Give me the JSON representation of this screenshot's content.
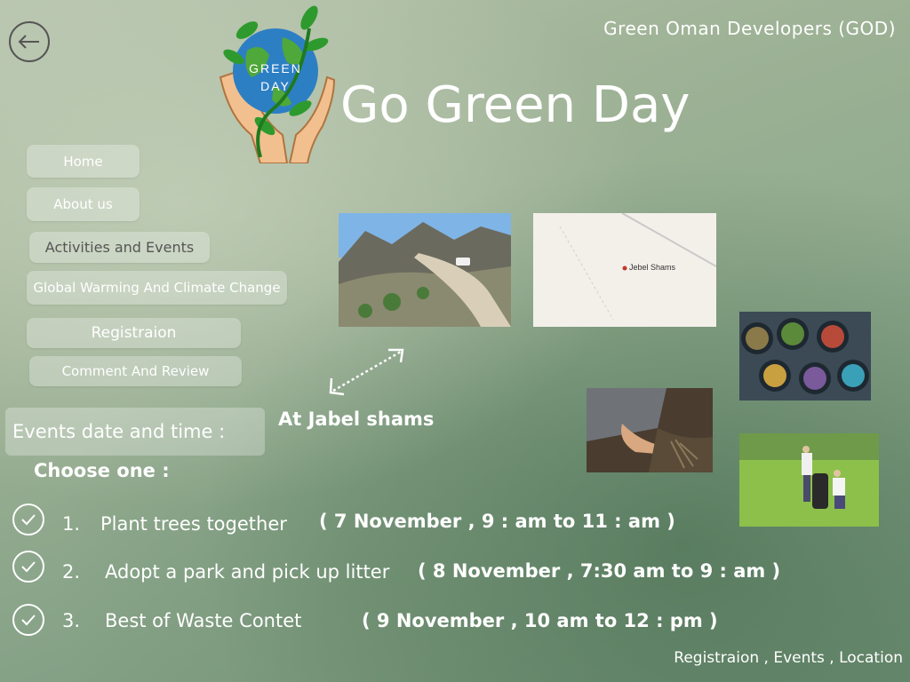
{
  "header": {
    "org_name": "Green Oman Developers (GOD)",
    "title": "Go Green Day",
    "logo_text": "GREEN DAY"
  },
  "nav": {
    "items": [
      {
        "label": "Home"
      },
      {
        "label": "About us"
      },
      {
        "label": "Activities and Events"
      },
      {
        "label": "Global Warming And Climate Change"
      },
      {
        "label": "Registraion"
      },
      {
        "label": "Comment And Review"
      }
    ]
  },
  "events": {
    "heading": "Events date and time  :",
    "choose_label": "Choose one :",
    "location_label": "At Jabel shams",
    "items": [
      {
        "num": "1.",
        "text": "Plant trees together",
        "date": "( 7 November ,  9 : am to 11 : am )"
      },
      {
        "num": "2.",
        "text": "Adopt a park and pick up litter",
        "date": "( 8 November ,   7:30 am to 9 : am )"
      },
      {
        "num": "3.",
        "text": "Best of Waste Contet",
        "date": "( 9 November ,   10 am to 12 : pm )"
      }
    ]
  },
  "map": {
    "place": "Jebel Shams"
  },
  "footer": {
    "links": "Registraion , Events , Location"
  },
  "icons": {
    "back": "back-arrow-icon",
    "check": "check-circle-icon",
    "arrow": "double-arrow-icon"
  },
  "colors": {
    "text": "#ffffff",
    "button_bg": "rgba(255,255,255,0.28)"
  }
}
